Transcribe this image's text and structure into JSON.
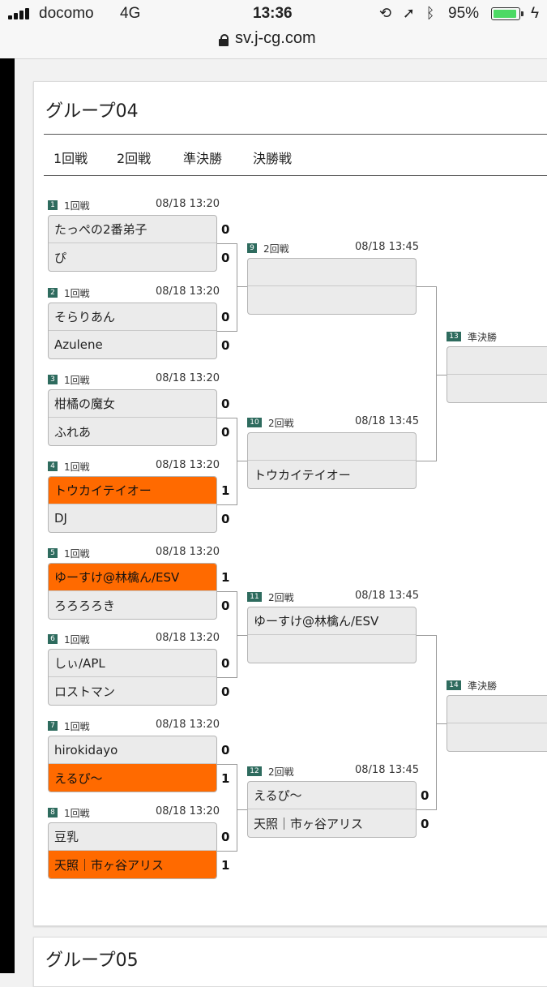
{
  "status_bar": {
    "carrier": "docomo",
    "network": "4G",
    "time": "13:36",
    "battery": "95%",
    "battery_level": 0.95
  },
  "browser": {
    "url": "sv.j-cg.com"
  },
  "group": {
    "title": "グループ04",
    "tabs": [
      "1回戦",
      "2回戦",
      "準決勝",
      "決勝戦"
    ]
  },
  "matches": [
    {
      "no": "1",
      "round": "1回戦",
      "time": "08/18 13:20",
      "p1": "たっぺの2番弟子",
      "s1": "0",
      "p2": "ぴ",
      "s2": "0",
      "winner": 0
    },
    {
      "no": "2",
      "round": "1回戦",
      "time": "08/18 13:20",
      "p1": "そらりあん",
      "s1": "0",
      "p2": "Azulene",
      "s2": "0",
      "winner": 0
    },
    {
      "no": "3",
      "round": "1回戦",
      "time": "08/18 13:20",
      "p1": "柑橘の魔女",
      "s1": "0",
      "p2": "ふれあ",
      "s2": "0",
      "winner": 0
    },
    {
      "no": "4",
      "round": "1回戦",
      "time": "08/18 13:20",
      "p1": "トウカイテイオー",
      "s1": "1",
      "p2": "DJ",
      "s2": "0",
      "winner": 1
    },
    {
      "no": "5",
      "round": "1回戦",
      "time": "08/18 13:20",
      "p1": "ゆーすけ@林檎ん/ESV",
      "s1": "1",
      "p2": "ろろろろき",
      "s2": "0",
      "winner": 1
    },
    {
      "no": "6",
      "round": "1回戦",
      "time": "08/18 13:20",
      "p1": "しぃ/APL",
      "s1": "0",
      "p2": "ロストマン",
      "s2": "0",
      "winner": 0
    },
    {
      "no": "7",
      "round": "1回戦",
      "time": "08/18 13:20",
      "p1": "hirokidayo",
      "s1": "0",
      "p2": "えるぴ〜",
      "s2": "1",
      "winner": 2
    },
    {
      "no": "8",
      "round": "1回戦",
      "time": "08/18 13:20",
      "p1": "豆乳",
      "s1": "0",
      "p2": "天照｜市ヶ谷アリス",
      "s2": "1",
      "winner": 2
    },
    {
      "no": "9",
      "round": "2回戦",
      "time": "08/18 13:45",
      "p1": "",
      "s1": "",
      "p2": "",
      "s2": "",
      "winner": 0
    },
    {
      "no": "10",
      "round": "2回戦",
      "time": "08/18 13:45",
      "p1": "",
      "s1": "",
      "p2": "トウカイテイオー",
      "s2": "",
      "winner": 0
    },
    {
      "no": "11",
      "round": "2回戦",
      "time": "08/18 13:45",
      "p1": "ゆーすけ@林檎ん/ESV",
      "s1": "",
      "p2": "",
      "s2": "",
      "winner": 0
    },
    {
      "no": "12",
      "round": "2回戦",
      "time": "08/18 13:45",
      "p1": "えるぴ〜",
      "s1": "0",
      "p2": "天照｜市ヶ谷アリス",
      "s2": "0",
      "winner": 0
    },
    {
      "no": "13",
      "round": "準決勝",
      "time": "",
      "p1": "",
      "s1": "",
      "p2": "",
      "s2": "",
      "winner": 0
    },
    {
      "no": "14",
      "round": "準決勝",
      "time": "",
      "p1": "",
      "s1": "",
      "p2": "",
      "s2": "",
      "winner": 0
    }
  ],
  "next_group": {
    "title": "グループ05"
  },
  "colors": {
    "winner": "#ff6a00",
    "badge": "#2e6b5e",
    "box": "#ebebeb"
  }
}
